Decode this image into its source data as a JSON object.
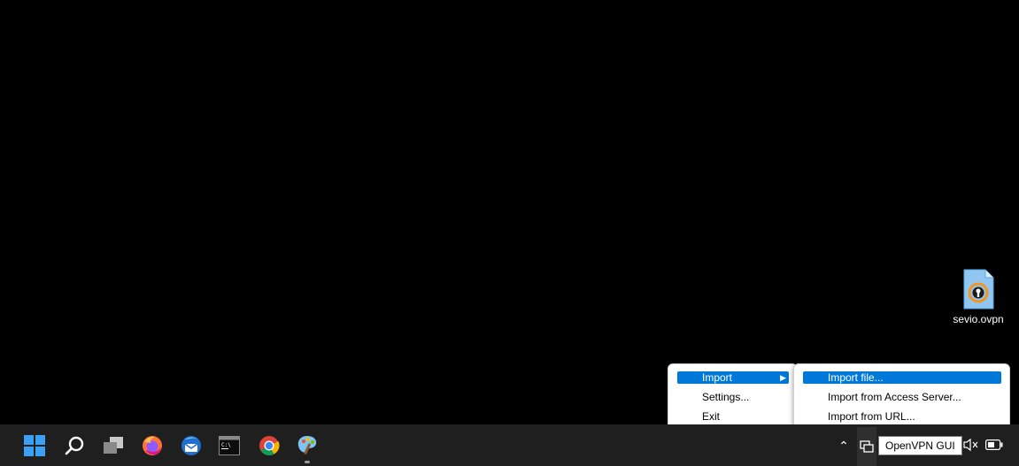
{
  "desktop": {
    "icons": [
      {
        "label": "sevio.ovpn",
        "icon": "openvpn-config-file-icon"
      }
    ]
  },
  "context_menu": {
    "items": [
      {
        "label": "Import",
        "has_submenu": true,
        "highlighted": true
      },
      {
        "label": "Settings..."
      },
      {
        "label": "Exit"
      }
    ]
  },
  "import_submenu": {
    "items": [
      {
        "label": "Import file...",
        "highlighted": true
      },
      {
        "label": "Import from Access Server..."
      },
      {
        "label": "Import from URL..."
      }
    ]
  },
  "taskbar": {
    "apps": [
      {
        "name": "start",
        "icon": "windows-start-icon"
      },
      {
        "name": "search",
        "icon": "search-icon"
      },
      {
        "name": "task-view",
        "icon": "task-view-icon"
      },
      {
        "name": "firefox",
        "icon": "firefox-icon"
      },
      {
        "name": "thunderbird",
        "icon": "thunderbird-icon"
      },
      {
        "name": "terminal",
        "icon": "terminal-icon"
      },
      {
        "name": "chrome",
        "icon": "chrome-icon"
      },
      {
        "name": "paint",
        "icon": "paint-icon",
        "running": true
      }
    ],
    "tray": {
      "tooltip": "OpenVPN GUI",
      "icons": [
        "chevron-up-icon",
        "network-icon",
        "volume-muted-icon",
        "battery-icon"
      ]
    }
  },
  "colors": {
    "desktop_bg": "#000000",
    "taskbar_bg": "#1f1f1f",
    "menu_highlight": "#0078d7",
    "openvpn_orange": "#f7941d"
  }
}
